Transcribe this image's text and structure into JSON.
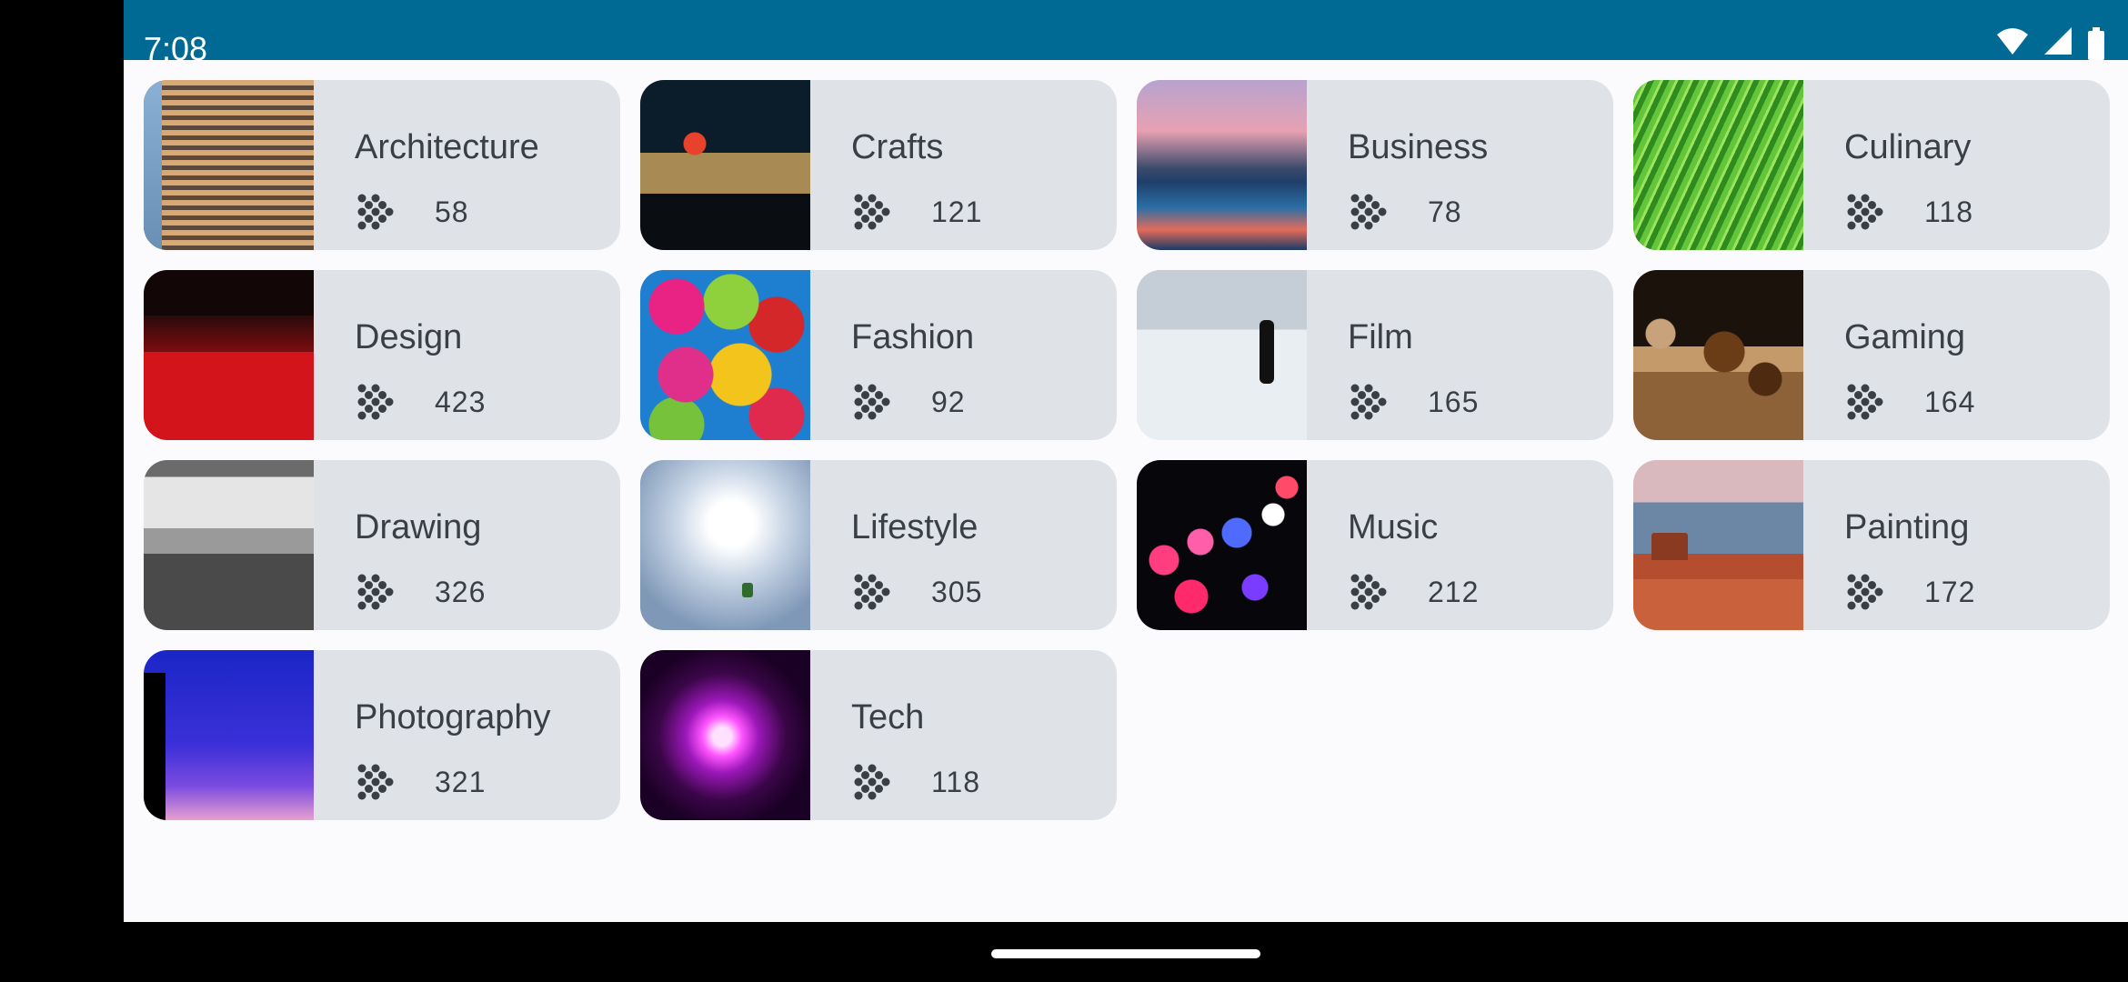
{
  "status_bar": {
    "time": "7:08",
    "icons": [
      "wifi-icon",
      "cellular-signal-icon",
      "battery-icon"
    ],
    "background_color": "#006994"
  },
  "topics": [
    {
      "name": "Architecture",
      "count": "58",
      "image": "architecture-photo"
    },
    {
      "name": "Crafts",
      "count": "121",
      "image": "crafts-photo"
    },
    {
      "name": "Business",
      "count": "78",
      "image": "business-photo"
    },
    {
      "name": "Culinary",
      "count": "118",
      "image": "culinary-photo"
    },
    {
      "name": "Design",
      "count": "423",
      "image": "design-photo"
    },
    {
      "name": "Fashion",
      "count": "92",
      "image": "fashion-photo"
    },
    {
      "name": "Film",
      "count": "165",
      "image": "film-photo"
    },
    {
      "name": "Gaming",
      "count": "164",
      "image": "gaming-photo"
    },
    {
      "name": "Drawing",
      "count": "326",
      "image": "drawing-photo"
    },
    {
      "name": "Lifestyle",
      "count": "305",
      "image": "lifestyle-photo"
    },
    {
      "name": "Music",
      "count": "212",
      "image": "music-photo"
    },
    {
      "name": "Painting",
      "count": "172",
      "image": "painting-photo"
    },
    {
      "name": "Photography",
      "count": "321",
      "image": "photography-photo"
    },
    {
      "name": "Tech",
      "count": "118",
      "image": "tech-photo"
    }
  ],
  "count_icon": "course-dots-icon",
  "colors": {
    "card_background": "#dfe3e8",
    "text": "#3a3f46",
    "app_background": "#fbfbfe"
  }
}
